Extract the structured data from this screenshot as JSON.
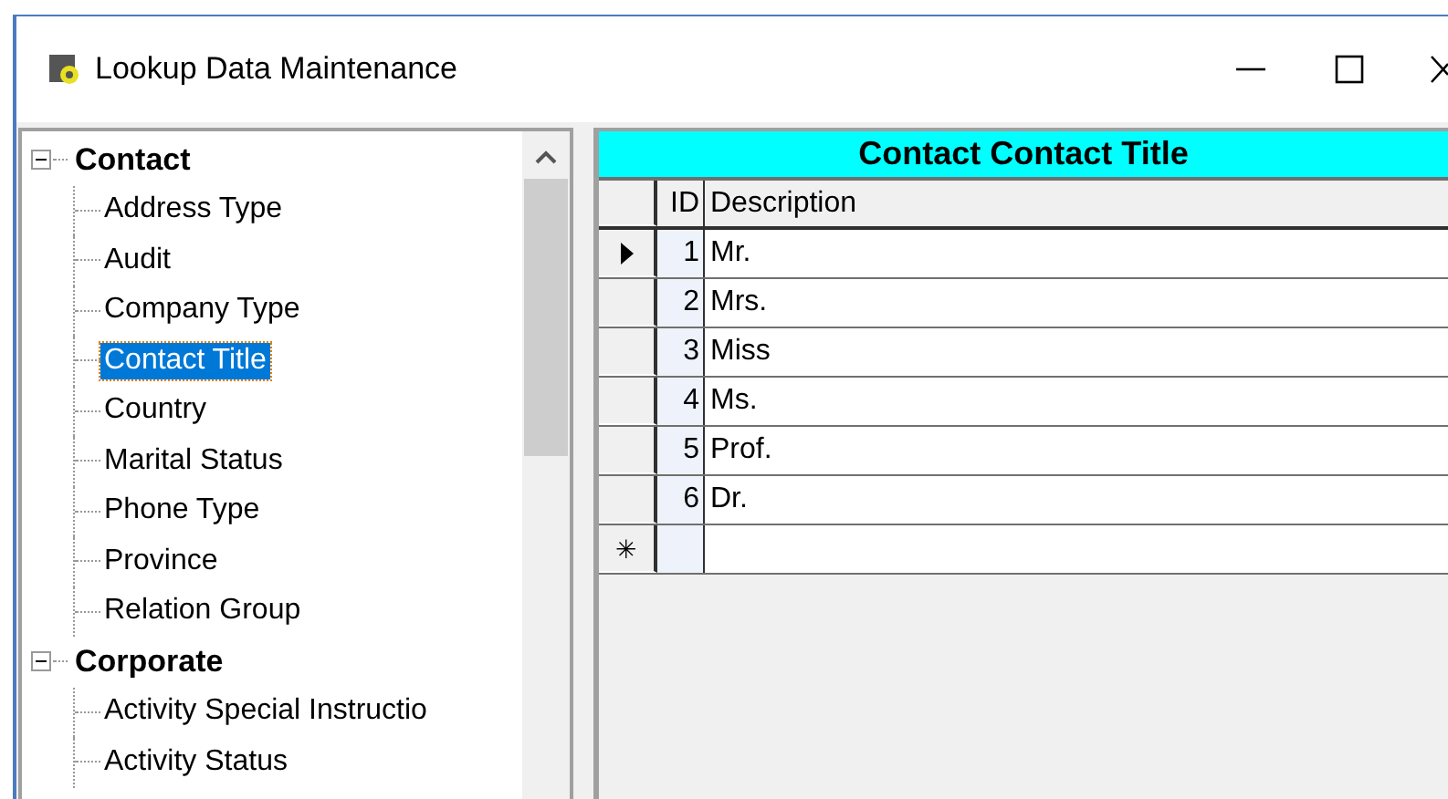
{
  "window": {
    "title": "Lookup Data Maintenance"
  },
  "tree": [
    {
      "label": "Contact",
      "expanded": true,
      "children": [
        {
          "label": "Address Type",
          "selected": false
        },
        {
          "label": "Audit",
          "selected": false
        },
        {
          "label": "Company Type",
          "selected": false
        },
        {
          "label": "Contact Title",
          "selected": true
        },
        {
          "label": "Country",
          "selected": false
        },
        {
          "label": "Marital Status",
          "selected": false
        },
        {
          "label": "Phone Type",
          "selected": false
        },
        {
          "label": "Province",
          "selected": false
        },
        {
          "label": "Relation Group",
          "selected": false
        }
      ]
    },
    {
      "label": "Corporate",
      "expanded": true,
      "children": [
        {
          "label": "Activity Special Instructio",
          "selected": false
        },
        {
          "label": "Activity Status",
          "selected": false
        }
      ]
    }
  ],
  "grid": {
    "title": "Contact Contact Title",
    "columns": [
      "ID",
      "Description"
    ],
    "rows": [
      {
        "id": "1",
        "description": "Mr.",
        "current": true
      },
      {
        "id": "2",
        "description": "Mrs.",
        "current": false
      },
      {
        "id": "3",
        "description": "Miss",
        "current": false
      },
      {
        "id": "4",
        "description": "Ms.",
        "current": false
      },
      {
        "id": "5",
        "description": "Prof.",
        "current": false
      },
      {
        "id": "6",
        "description": "Dr.",
        "current": false
      }
    ],
    "new_row_marker": "✳"
  }
}
